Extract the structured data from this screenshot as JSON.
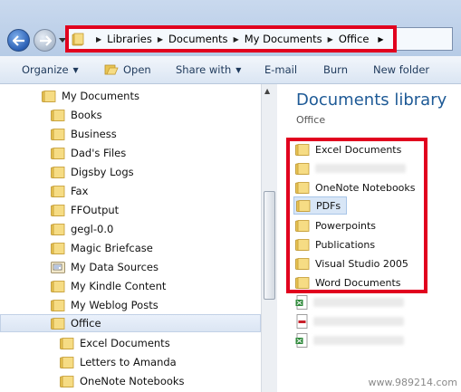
{
  "address_bar": {
    "breadcrumbs": [
      "Libraries",
      "Documents",
      "My Documents",
      "Office"
    ]
  },
  "toolbar": {
    "organize": "Organize",
    "open": "Open",
    "share_with": "Share with",
    "email": "E-mail",
    "burn": "Burn",
    "new_folder": "New folder"
  },
  "nav_tree": {
    "root": "My Documents",
    "items": [
      "Books",
      "Business",
      "Dad's Files",
      "Digsby Logs",
      "Fax",
      "FFOutput",
      "gegl-0.0",
      "Magic Briefcase",
      "My Data Sources",
      "My Kindle Content",
      "My Weblog Posts",
      "Office"
    ],
    "office_children": [
      "Excel Documents",
      "Letters to Amanda",
      "OneNote Notebooks"
    ]
  },
  "library": {
    "title": "Documents library",
    "subtitle": "Office",
    "folders": [
      "Excel Documents",
      "",
      "OneNote Notebooks",
      "PDFs",
      "Powerpoints",
      "Publications",
      "Visual Studio 2005",
      "Word Documents"
    ]
  },
  "watermark": "www.989214.com",
  "colors": {
    "highlight_red": "#e1001e",
    "title_blue": "#1e5a96",
    "folder_yellow": "#e8c454"
  }
}
